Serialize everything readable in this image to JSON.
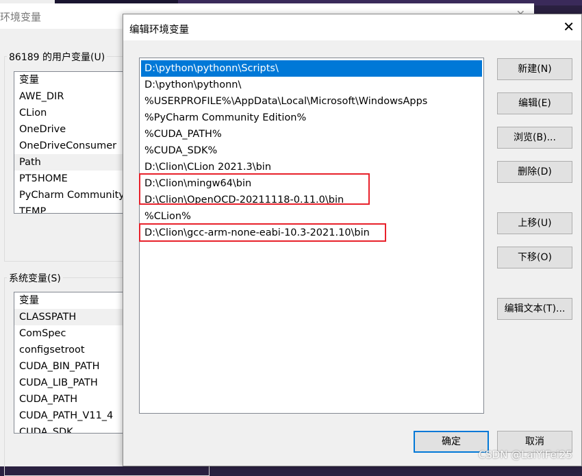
{
  "background_window": {
    "title": "环境变量",
    "user_group": "86189 的用户变量(U)",
    "user_vars": [
      "变量",
      "AWE_DIR",
      "CLion",
      "OneDrive",
      "OneDriveConsumer",
      "Path",
      "PT5HOME",
      "PyCharm Community",
      "TEMP"
    ],
    "user_selected": "Path",
    "system_group": "系统变量(S)",
    "system_vars": [
      "变量",
      "CLASSPATH",
      "ComSpec",
      "configsetroot",
      "CUDA_BIN_PATH",
      "CUDA_LIB_PATH",
      "CUDA_PATH",
      "CUDA_PATH_V11_4",
      "CUDA_SDK"
    ],
    "system_selected": "CLASSPATH"
  },
  "dialog": {
    "title": "编辑环境变量",
    "close": "✕",
    "paths": [
      "D:\\python\\pythonn\\Scripts\\",
      "D:\\python\\pythonn\\",
      "%USERPROFILE%\\AppData\\Local\\Microsoft\\WindowsApps",
      "%PyCharm Community Edition%",
      "%CUDA_PATH%",
      "%CUDA_SDK%",
      "D:\\Clion\\CLion 2021.3\\bin",
      "D:\\Clion\\mingw64\\bin",
      "D:\\Clion\\OpenOCD-20211118-0.11.0\\bin",
      "%CLion%",
      "D:\\Clion\\gcc-arm-none-eabi-10.3-2021.10\\bin"
    ],
    "selected_index": 0,
    "highlight_color": "#e8202a",
    "buttons": {
      "new": "新建(N)",
      "edit": "编辑(E)",
      "browse": "浏览(B)...",
      "delete": "删除(D)",
      "up": "上移(U)",
      "down": "下移(O)",
      "edit_text": "编辑文本(T)...",
      "ok": "确定",
      "cancel": "取消"
    }
  },
  "watermark": "CSDN @LaiYiFei25"
}
